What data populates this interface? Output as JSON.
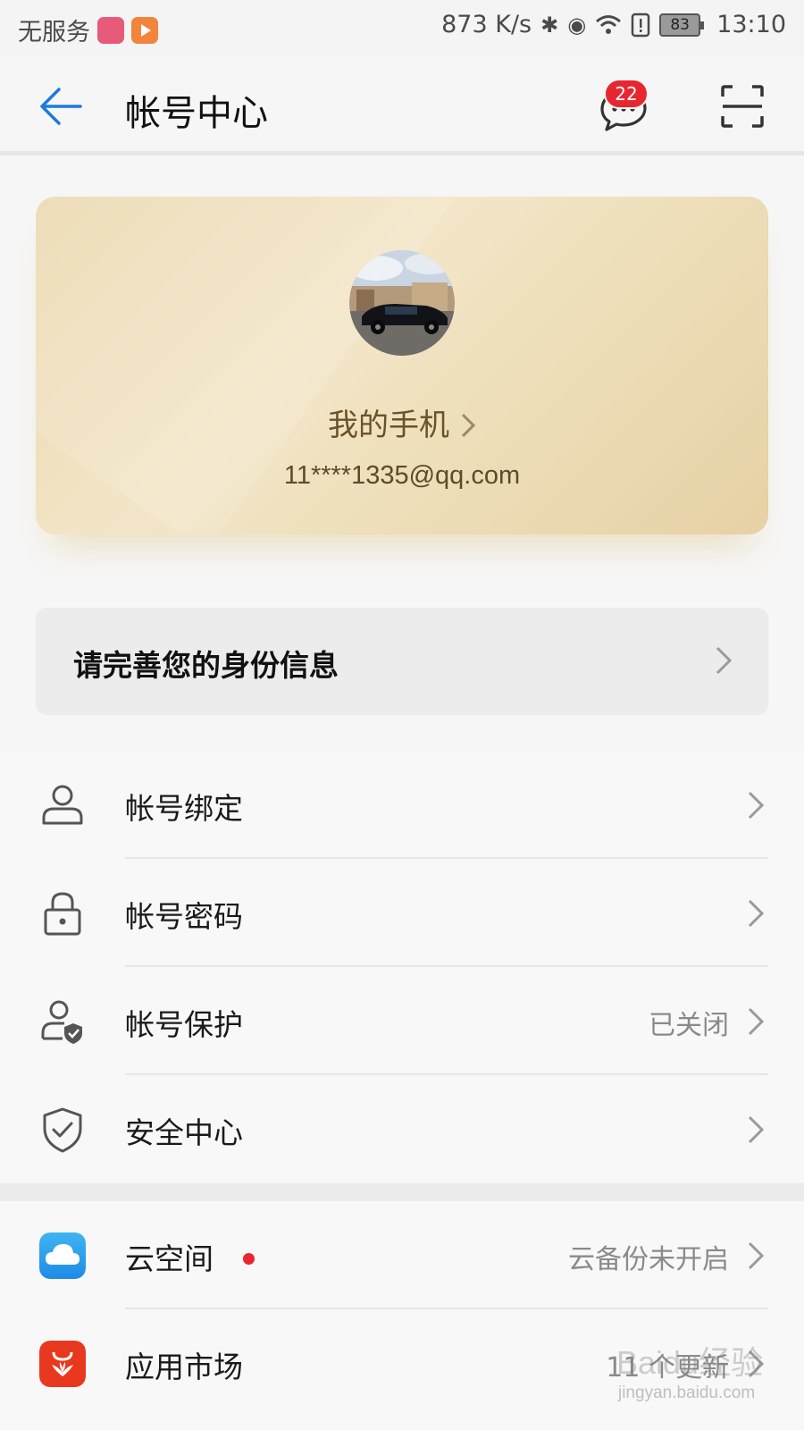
{
  "status_bar": {
    "carrier": "无服务",
    "network_speed": "873 K/s",
    "battery": "83",
    "time": "13:10"
  },
  "header": {
    "title": "帐号中心",
    "message_badge": "22",
    "icons": [
      "back-arrow-icon",
      "message-icon",
      "scan-icon"
    ]
  },
  "profile_card": {
    "name": "我的手机",
    "email": "11****1335@qq.com"
  },
  "identity_banner": {
    "label": "请完善您的身份信息"
  },
  "account_items": [
    {
      "label": "帐号绑定",
      "status": "",
      "icon": "person-icon"
    },
    {
      "label": "帐号密码",
      "status": "",
      "icon": "lock-icon"
    },
    {
      "label": "帐号保护",
      "status": "已关闭",
      "icon": "person-shield-icon"
    },
    {
      "label": "安全中心",
      "status": "",
      "icon": "shield-check-icon"
    }
  ],
  "service_items": [
    {
      "label": "云空间",
      "status": "云备份未开启",
      "icon": "cloud-icon",
      "has_dot": true
    },
    {
      "label": "应用市场",
      "status": "11 个更新",
      "icon": "app-market-icon"
    }
  ],
  "watermark": {
    "text": "Baidu经验",
    "url": "jingyan.baidu.com"
  },
  "colors": {
    "accent_blue": "#1e7ad8",
    "badge_red": "#e8262f",
    "card_gold": "#ecdcb5"
  }
}
